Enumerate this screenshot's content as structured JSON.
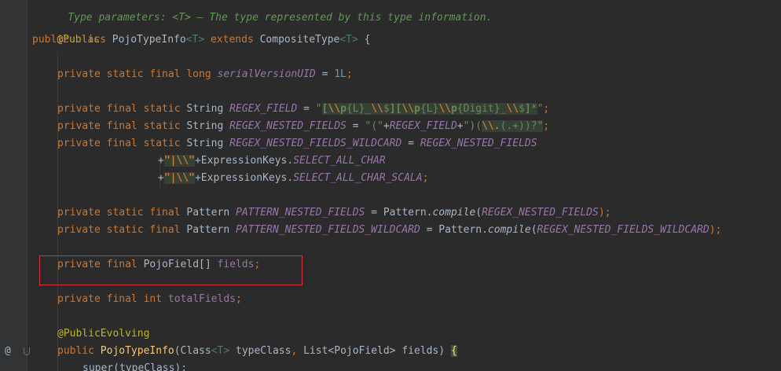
{
  "doc_comment": "Type parameters: <T> – The type represented by this type information.",
  "code": {
    "l1_ann": "@Public",
    "l2_kw1": "public class",
    "l2_name": "PojoTypeInfo",
    "l2_tp1": "<T>",
    "l2_kw2": "extends",
    "l2_super": "CompositeType",
    "l2_tp2": "<T>",
    "l2_brace": "{",
    "l3_kw": "private static final long",
    "l3_fld": "serialVersionUID",
    "l3_eq": "=",
    "l3_num": "1L",
    "l3_semi": ";",
    "l4_kw": "private final static",
    "l4_type": "String",
    "l4_fld": "REGEX_FIELD",
    "l4_eq": "=",
    "l4_q1": "\"",
    "l4_r1": "[",
    "l4_r2": "\\\\",
    "l4_r3": "p",
    "l4_r4": "{L}",
    "l4_r5": "_",
    "l4_r6": "\\\\",
    "l4_r7": "$",
    "l4_r8": "][",
    "l4_r9": "\\\\",
    "l4_r10": "p",
    "l4_r11": "{L}",
    "l4_r12": "\\\\",
    "l4_r13": "p",
    "l4_r14": "{Digit}",
    "l4_r15": "_",
    "l4_r16": "\\\\",
    "l4_r17": "$",
    "l4_r18": "]",
    "l4_r19": "*",
    "l4_q2": "\"",
    "l4_semi": ";",
    "l5_kw": "private final static",
    "l5_type": "String",
    "l5_fld": "REGEX_NESTED_FIELDS",
    "l5_eq": "=",
    "l5_s1": "\"(\"",
    "l5_plus1": "+",
    "l5_ref": "REGEX_FIELD",
    "l5_plus2": "+",
    "l5_s2a": "\")(",
    "l5_s2b": "\\\\.",
    "l5_s2c": "(.+))?\"",
    "l5_semi": ";",
    "l6_kw": "private final static",
    "l6_type": "String",
    "l6_fld": "REGEX_NESTED_FIELDS_WILDCARD",
    "l6_eq": "=",
    "l6_ref": "REGEX_NESTED_FIELDS",
    "l7_plus1": "+",
    "l7_s": "\"|\\\\\"",
    "l7_plus2": "+",
    "l7_cls": "ExpressionKeys.",
    "l7_fld": "SELECT_ALL_CHAR",
    "l8_plus1": "+",
    "l8_s": "\"|\\\\\"",
    "l8_plus2": "+",
    "l8_cls": "ExpressionKeys.",
    "l8_fld": "SELECT_ALL_CHAR_SCALA",
    "l8_semi": ";",
    "l9_kw": "private static final",
    "l9_type": "Pattern",
    "l9_fld": "PATTERN_NESTED_FIELDS",
    "l9_eq": "= Pattern.",
    "l9_m": "compile",
    "l9_p1": "(",
    "l9_arg": "REGEX_NESTED_FIELDS",
    "l9_p2": ");",
    "l10_kw": "private static final",
    "l10_type": "Pattern",
    "l10_fld": "PATTERN_NESTED_FIELDS_WILDCARD",
    "l10_eq": "= Pattern.",
    "l10_m": "compile",
    "l10_p1": "(",
    "l10_arg": "REGEX_NESTED_FIELDS_WILDCARD",
    "l10_p2": ");",
    "l11_kw": "private final",
    "l11_type": "PojoField[]",
    "l11_fld": "fields",
    "l11_semi": ";",
    "l12_kw": "private final int",
    "l12_fld": "totalFields",
    "l12_semi": ";",
    "l13_ann": "@PublicEvolving",
    "l14_kw": "public",
    "l14_name": "PojoTypeInfo",
    "l14_p1": "(Class",
    "l14_tp": "<T>",
    "l14_p2": "typeClass",
    "l14_c": ",",
    "l14_p3": "List<PojoField> fields)",
    "l14_brace": "{",
    "l15_call": "super(typeClass);"
  },
  "gutter": {
    "at_marker": "@"
  }
}
